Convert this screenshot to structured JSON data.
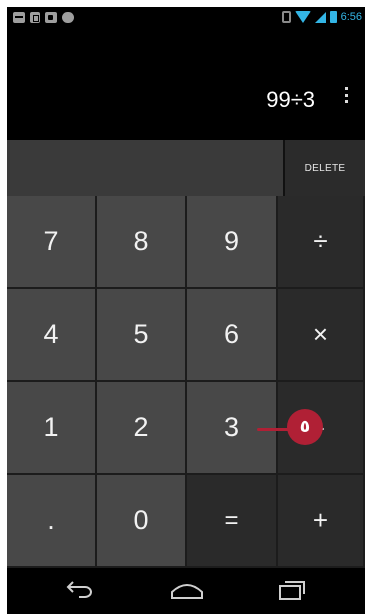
{
  "status_bar": {
    "notification_icons": [
      "chat-icon",
      "sd-card-icon",
      "media-icon",
      "game-icon"
    ],
    "system_icons": [
      "vibrate-icon",
      "wifi-icon",
      "signal-icon",
      "battery-icon"
    ],
    "time": "6:56",
    "accent_color": "#33b5e5"
  },
  "display": {
    "formula": "99÷3",
    "menu_icon": "overflow-menu-icon"
  },
  "controls": {
    "delete_label": "DELETE"
  },
  "keypad": {
    "row1": [
      "7",
      "8",
      "9",
      "÷"
    ],
    "row2": [
      "4",
      "5",
      "6",
      "×"
    ],
    "row3": [
      "1",
      "2",
      "3",
      "-"
    ],
    "row4": [
      ".",
      "0",
      "=",
      "+"
    ]
  },
  "annotation": {
    "marker": "٥",
    "color": "#b02035"
  },
  "navigation": {
    "icons": [
      "back-icon",
      "home-icon",
      "recent-apps-icon"
    ]
  }
}
